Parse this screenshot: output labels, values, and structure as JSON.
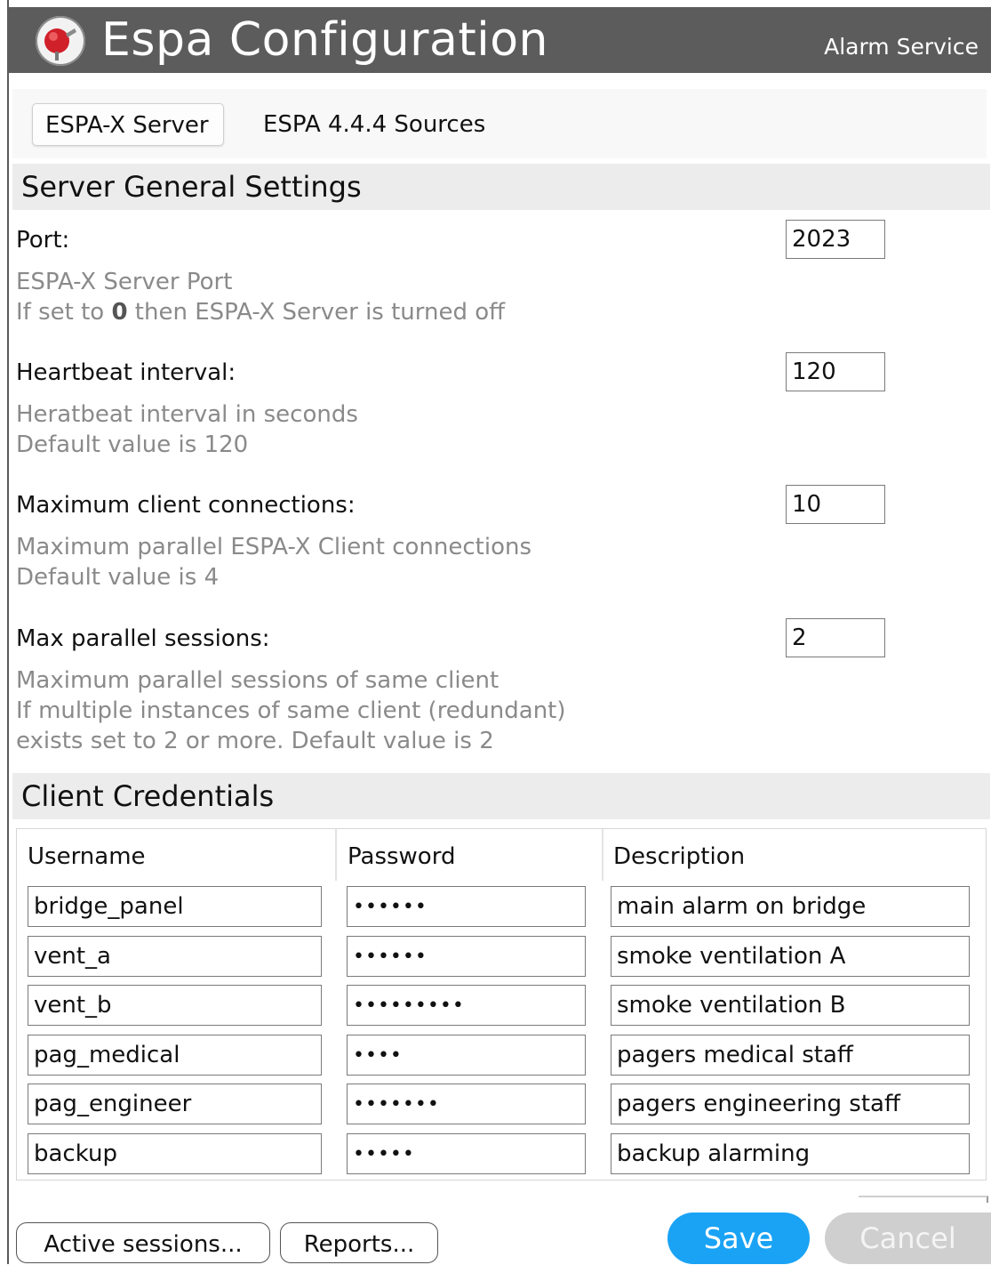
{
  "app": {
    "title": "Espa Configuration",
    "subtitle": "Alarm Service",
    "icon": "alarm-bell-icon"
  },
  "tabs": [
    {
      "label": "ESPA-X Server",
      "active": true
    },
    {
      "label": "ESPA 4.4.4 Sources",
      "active": false
    }
  ],
  "server_settings": {
    "heading": "Server General Settings",
    "port": {
      "label": "Port:",
      "value": "2023",
      "hint_line1": "ESPA-X Server Port",
      "hint_line2_pre": "If set to ",
      "hint_line2_bold": "0",
      "hint_line2_post": " then ESPA-X Server is turned off"
    },
    "heartbeat": {
      "label": "Heartbeat interval:",
      "value": "120",
      "hint_line1": "Heratbeat interval in seconds",
      "hint_line2": "Default value is 120"
    },
    "max_clients": {
      "label": "Maximum client connections:",
      "value": "10",
      "hint_line1": "Maximum parallel ESPA-X Client connections",
      "hint_line2": "Default value is 4"
    },
    "max_sessions": {
      "label": "Max parallel sessions:",
      "value": "2",
      "hint_line1": "Maximum parallel sessions of same client",
      "hint_line2": "If multiple instances of same client (redundant)",
      "hint_line3": "exists set to 2 or more. Default value is 2"
    }
  },
  "credentials": {
    "heading": "Client Credentials",
    "columns": {
      "username": "Username",
      "password": "Password",
      "description": "Description"
    },
    "rows": [
      {
        "username": "bridge_panel",
        "password": "••••••",
        "description": "main alarm on bridge"
      },
      {
        "username": "vent_a",
        "password": "••••••",
        "description": "smoke ventilation A"
      },
      {
        "username": "vent_b",
        "password": "•••••••••",
        "description": "smoke ventilation B"
      },
      {
        "username": "pag_medical",
        "password": "••••",
        "description": "pagers medical staff"
      },
      {
        "username": "pag_engineer",
        "password": "•••••••",
        "description": "pagers engineering staff"
      },
      {
        "username": "backup",
        "password": "•••••",
        "description": "backup alarming"
      }
    ]
  },
  "footer": {
    "active_sessions_label": "Active sessions...",
    "reports_label": "Reports...",
    "save_label": "Save",
    "cancel_label": "Cancel"
  },
  "colors": {
    "titlebar": "#5c5c5c",
    "save": "#1aa3f5",
    "cancel_disabled": "#cfcfcf",
    "hint_text": "#8a8a8a"
  }
}
